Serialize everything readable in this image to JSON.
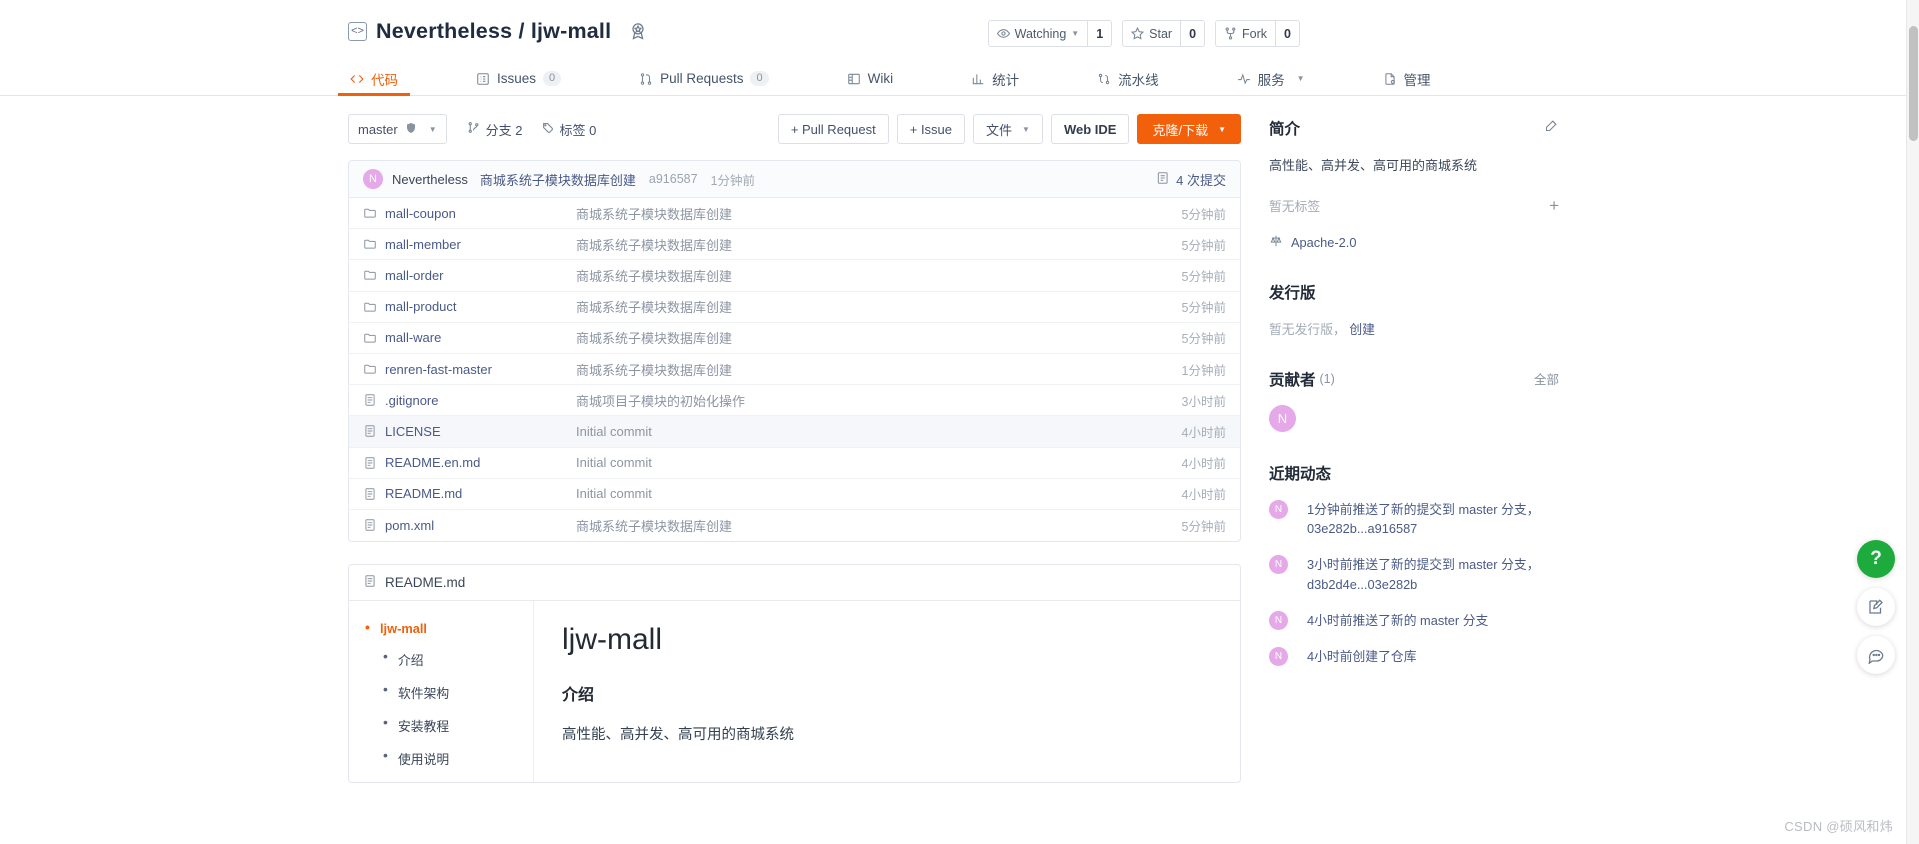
{
  "header": {
    "owner": "Nevertheless",
    "separator": "/",
    "repo": "ljw-mall",
    "repo_icon": "code-brackets-icon",
    "badge_icon": "award-badge-icon",
    "actions": {
      "watch_label": "Watching",
      "watch_count": "1",
      "star_label": "Star",
      "star_count": "0",
      "fork_label": "Fork",
      "fork_count": "0"
    }
  },
  "nav": {
    "items": [
      {
        "label": "代码",
        "icon": "code-icon",
        "count": null,
        "active": true
      },
      {
        "label": "Issues",
        "icon": "issue-icon",
        "count": "0",
        "active": false
      },
      {
        "label": "Pull Requests",
        "icon": "pull-request-icon",
        "count": "0",
        "active": false
      },
      {
        "label": "Wiki",
        "icon": "book-icon",
        "count": null,
        "active": false
      },
      {
        "label": "统计",
        "icon": "chart-icon",
        "count": null,
        "active": false
      },
      {
        "label": "流水线",
        "icon": "pipeline-icon",
        "count": null,
        "active": false
      },
      {
        "label": "服务",
        "icon": "activity-icon",
        "count": null,
        "active": false,
        "caret": true
      },
      {
        "label": "管理",
        "icon": "settings-doc-icon",
        "count": null,
        "active": false
      }
    ]
  },
  "toolbar": {
    "branch": "master",
    "branch_icon": "shield-icon",
    "branches_label": "分支 2",
    "tags_label": "标签 0",
    "pull_request_btn": "+ Pull Request",
    "issue_btn": "+ Issue",
    "files_btn": "文件",
    "webide_btn": "Web IDE",
    "clone_btn": "克隆/下载"
  },
  "commit_bar": {
    "avatar_letter": "N",
    "author": "Nevertheless",
    "message": "商城系统子模块数据库创建",
    "sha": "a916587",
    "time": "1分钟前",
    "commit_count": "4 次提交",
    "history_icon": "history-icon"
  },
  "files": [
    {
      "name": "mall-coupon",
      "type": "folder",
      "message": "商城系统子模块数据库创建",
      "time": "5分钟前",
      "highlight": false
    },
    {
      "name": "mall-member",
      "type": "folder",
      "message": "商城系统子模块数据库创建",
      "time": "5分钟前",
      "highlight": false
    },
    {
      "name": "mall-order",
      "type": "folder",
      "message": "商城系统子模块数据库创建",
      "time": "5分钟前",
      "highlight": false
    },
    {
      "name": "mall-product",
      "type": "folder",
      "message": "商城系统子模块数据库创建",
      "time": "5分钟前",
      "highlight": false
    },
    {
      "name": "mall-ware",
      "type": "folder",
      "message": "商城系统子模块数据库创建",
      "time": "5分钟前",
      "highlight": false
    },
    {
      "name": "renren-fast-master",
      "type": "folder",
      "message": "商城系统子模块数据库创建",
      "time": "1分钟前",
      "highlight": false
    },
    {
      "name": ".gitignore",
      "type": "file",
      "message": "商城项目子模块的初始化操作",
      "time": "3小时前",
      "highlight": false
    },
    {
      "name": "LICENSE",
      "type": "file",
      "message": "Initial commit",
      "time": "4小时前",
      "highlight": true
    },
    {
      "name": "README.en.md",
      "type": "file",
      "message": "Initial commit",
      "time": "4小时前",
      "highlight": false
    },
    {
      "name": "README.md",
      "type": "file",
      "message": "Initial commit",
      "time": "4小时前",
      "highlight": false
    },
    {
      "name": "pom.xml",
      "type": "file",
      "message": "商城系统子模块数据库创建",
      "time": "5分钟前",
      "highlight": false
    }
  ],
  "readme": {
    "filename": "README.md",
    "file_icon": "file-text-icon",
    "toc": [
      {
        "label": "ljw-mall",
        "active": true
      },
      {
        "label": "介绍",
        "active": false
      },
      {
        "label": "软件架构",
        "active": false
      },
      {
        "label": "安装教程",
        "active": false
      },
      {
        "label": "使用说明",
        "active": false
      }
    ],
    "h1": "ljw-mall",
    "h2": "介绍",
    "paragraph": "高性能、高并发、高可用的商城系统"
  },
  "sidebar": {
    "about_title": "简介",
    "about_edit_icon": "edit-icon",
    "description": "高性能、高并发、高可用的商城系统",
    "no_tags": "暂无标签",
    "add_tag_icon": "plus-icon",
    "license": "Apache-2.0",
    "license_icon": "scale-icon",
    "release_title": "发行版",
    "release_empty": "暂无发行版，",
    "release_create": "创建",
    "contributors_title": "贡献者",
    "contributors_count": "(1)",
    "contributors_all": "全部",
    "contributor_avatar": "N",
    "activity_title": "近期动态",
    "activity": [
      {
        "avatar": "N",
        "text": "1分钟前推送了新的提交到 master 分支，03e282b...a916587"
      },
      {
        "avatar": "N",
        "text": "3小时前推送了新的提交到 master 分支，d3b2d4e...03e282b"
      },
      {
        "avatar": "N",
        "text": "4小时前推送了新的 master 分支"
      },
      {
        "avatar": "N",
        "text": "4小时前创建了仓库"
      }
    ]
  },
  "fabs": [
    {
      "icon": "help-icon",
      "glyph": "?",
      "style": "green"
    },
    {
      "icon": "feedback-icon",
      "glyph": "",
      "style": "white"
    },
    {
      "icon": "comment-icon",
      "glyph": "",
      "style": "white"
    }
  ],
  "watermark": "CSDN @硕风和炜",
  "colors": {
    "accent": "#f2600c",
    "link": "#4a5a87",
    "avatar": "#e5a8e8",
    "help": "#1eab3d"
  }
}
